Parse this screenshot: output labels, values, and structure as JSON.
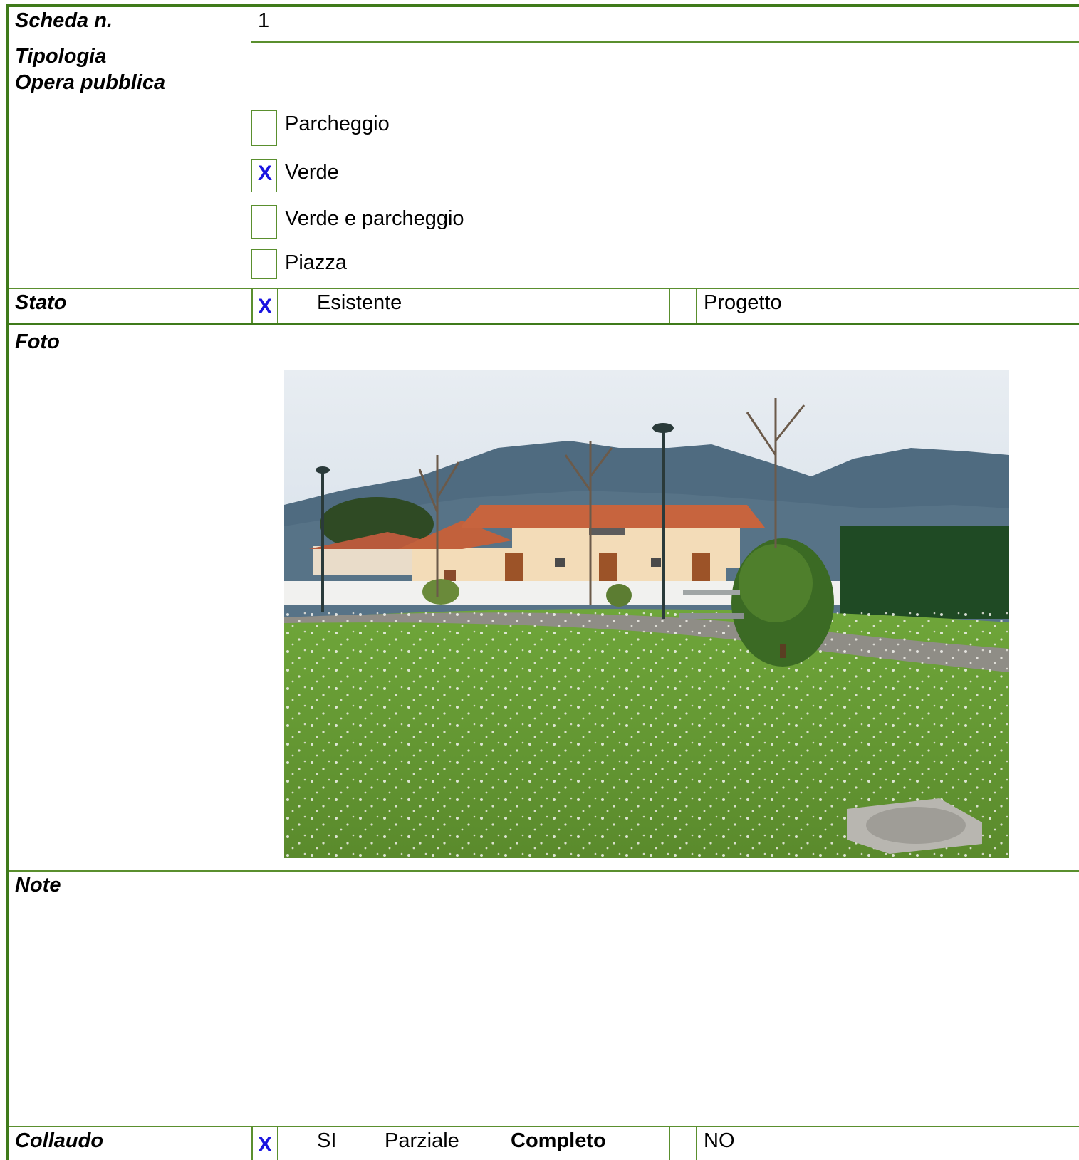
{
  "header": {
    "scheda_label": "Scheda n.",
    "scheda_value": "1"
  },
  "tipologia": {
    "label_line1": "Tipologia",
    "label_line2": "Opera pubblica",
    "options": [
      {
        "label": "Parcheggio",
        "checked": false,
        "mark": ""
      },
      {
        "label": "Verde",
        "checked": true,
        "mark": "X"
      },
      {
        "label": "Verde e parcheggio",
        "checked": false,
        "mark": ""
      },
      {
        "label": "Piazza",
        "checked": false,
        "mark": ""
      }
    ]
  },
  "stato": {
    "label": "Stato",
    "mark": "X",
    "esistente": "Esistente",
    "progetto": "Progetto"
  },
  "foto": {
    "label": "Foto",
    "photo_subject": "park-lawn-with-house-and-mountains"
  },
  "note": {
    "label": "Note"
  },
  "collaudo": {
    "label": "Collaudo",
    "mark": "X",
    "si": "SI",
    "parziale": "Parziale",
    "completo": "Completo",
    "no": "NO"
  },
  "colors": {
    "frame": "#3f7a1a",
    "rule": "#5a8f2e",
    "mark": "#1a14e0"
  }
}
